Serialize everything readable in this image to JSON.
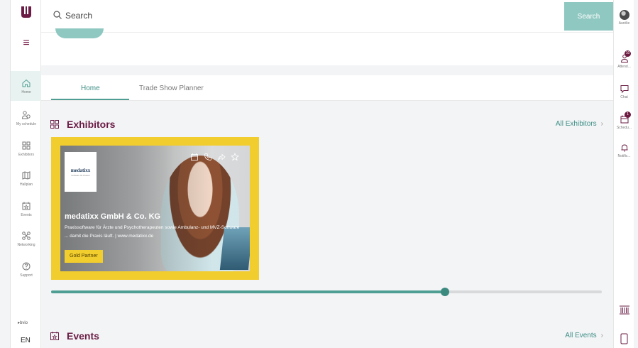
{
  "left_nav": {
    "items": [
      {
        "label": "Home",
        "icon": "home-icon"
      },
      {
        "label": "My schedule",
        "icon": "people-icon"
      },
      {
        "label": "Exhibitors",
        "icon": "grid-icon"
      },
      {
        "label": "Hallplan",
        "icon": "map-icon"
      },
      {
        "label": "Events",
        "icon": "calendar-star-icon"
      },
      {
        "label": "Networking",
        "icon": "network-icon"
      },
      {
        "label": "Support",
        "icon": "help-icon"
      }
    ],
    "footer_logo_text": "▸bvio",
    "language": "EN"
  },
  "search": {
    "placeholder": "Search",
    "button_label": "Search"
  },
  "right_rail": {
    "user_label": "Aurélie",
    "attendees": {
      "label": "Attend...",
      "badge": "10"
    },
    "chat": {
      "label": "Chat"
    },
    "schedule": {
      "label": "Schedu...",
      "badge": "1"
    },
    "notifications": {
      "label": "Notific..."
    }
  },
  "tabs": [
    {
      "label": "Home",
      "active": true
    },
    {
      "label": "Trade Show Planner",
      "active": false
    }
  ],
  "exhibitors": {
    "title": "Exhibitors",
    "link": "All Exhibitors",
    "card": {
      "logo_text": "medatixx",
      "logo_subtext": "Software für Praxen",
      "name": "medatixx GmbH & Co. KG",
      "description": "Praxissoftware für Ärzte und Psychotherapeuten sowie Ambulanz- und MVZ-Software ... damit die Praxis läuft. | www.medatixx.de",
      "badge": "Gold Partner",
      "accent_color": "#f2cd2e"
    },
    "scroll_progress": 0.715
  },
  "events": {
    "title": "Events",
    "link": "All Events"
  },
  "colors": {
    "brand": "#6a1c44",
    "accent": "#4f9e94",
    "search_button": "#8fc8c1"
  }
}
